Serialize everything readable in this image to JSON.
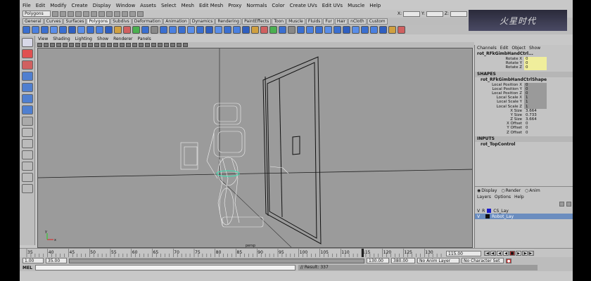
{
  "menus": [
    "File",
    "Edit",
    "Modify",
    "Create",
    "Display",
    "Window",
    "Assets",
    "Select",
    "Mesh",
    "Edit Mesh",
    "Proxy",
    "Normals",
    "Color",
    "Create UVs",
    "Edit UVs",
    "Muscle",
    "Help"
  ],
  "status_line": {
    "mode": "Polygons",
    "x_label": "X:",
    "y_label": "Y:",
    "z_label": "Z:"
  },
  "shelf_tabs": [
    "General",
    "Curves",
    "Surfaces",
    "Polygons",
    "Subdivs",
    "Deformation",
    "Animation",
    "Dynamics",
    "Rendering",
    "PaintEffects",
    "Toon",
    "Muscle",
    "Fluids",
    "Fur",
    "Hair",
    "nCloth",
    "Custom"
  ],
  "active_shelf_tab": "Polygons",
  "panel_menu": [
    "View",
    "Shading",
    "Lighting",
    "Show",
    "Renderer",
    "Panels"
  ],
  "channel_box": {
    "menu": [
      "Channels",
      "Edit",
      "Object",
      "Show"
    ],
    "node": "rot_RFkGimbHandCtrl...",
    "attributes": [
      {
        "name": "Rotate X",
        "value": "0",
        "style": "yellow"
      },
      {
        "name": "Rotate Y",
        "value": "0",
        "style": "yellow"
      },
      {
        "name": "Rotate Z",
        "value": "0",
        "style": "yellow"
      }
    ],
    "shapes_label": "SHAPES",
    "shape_node": "rot_RFkGimbHandCtrlShape",
    "shape_attributes": [
      {
        "name": "Local Position X",
        "value": "0",
        "style": "gray"
      },
      {
        "name": "Local Position Y",
        "value": "0",
        "style": "gray"
      },
      {
        "name": "Local Position Z",
        "value": "0",
        "style": "gray"
      },
      {
        "name": "Local Scale X",
        "value": "1",
        "style": "gray"
      },
      {
        "name": "Local Scale Y",
        "value": "1",
        "style": "gray"
      },
      {
        "name": "Local Scale Z",
        "value": "1",
        "style": "gray"
      },
      {
        "name": "X Size",
        "value": "3.664",
        "style": "plain"
      },
      {
        "name": "Y Size",
        "value": "0.733",
        "style": "plain"
      },
      {
        "name": "Z Size",
        "value": "3.664",
        "style": "plain"
      },
      {
        "name": "X Offset",
        "value": "0",
        "style": "plain"
      },
      {
        "name": "Y Offset",
        "value": "0",
        "style": "plain"
      },
      {
        "name": "Z Offset",
        "value": "0",
        "style": "plain"
      }
    ],
    "inputs_label": "INPUTS",
    "input_node": "rot_TopControl"
  },
  "layer_editor": {
    "modes": [
      "Display",
      "Render",
      "Anim"
    ],
    "active_mode": "Display",
    "menu": [
      "Layers",
      "Options",
      "Help"
    ],
    "layers": [
      {
        "v": "V",
        "r": "R",
        "name": "CS_Lay",
        "color": "#1a1acc",
        "selected": false
      },
      {
        "v": "V",
        "r": "",
        "name": "Robot_Lay",
        "color": "#111111",
        "selected": true
      }
    ]
  },
  "time_slider": {
    "labels": [
      "35",
      "40",
      "45",
      "50",
      "55",
      "60",
      "65",
      "70",
      "75",
      "80",
      "85",
      "90",
      "95",
      "100",
      "105",
      "110",
      "115",
      "120",
      "125",
      "130"
    ],
    "current_frame": "115",
    "current_field": "115.00"
  },
  "range_slider": {
    "start": "1.00",
    "inner_start": "35.00",
    "inner_end": "130.00",
    "end": "380.00",
    "anim_layer": "No Anim Layer",
    "char_set": "No Character Set"
  },
  "command_line": {
    "label": "MEL",
    "result": "// Result: 337"
  },
  "viewport": {
    "axis_x": "x",
    "axis_y": "y",
    "persp_label": "persp"
  },
  "logo_text": "火星时代"
}
